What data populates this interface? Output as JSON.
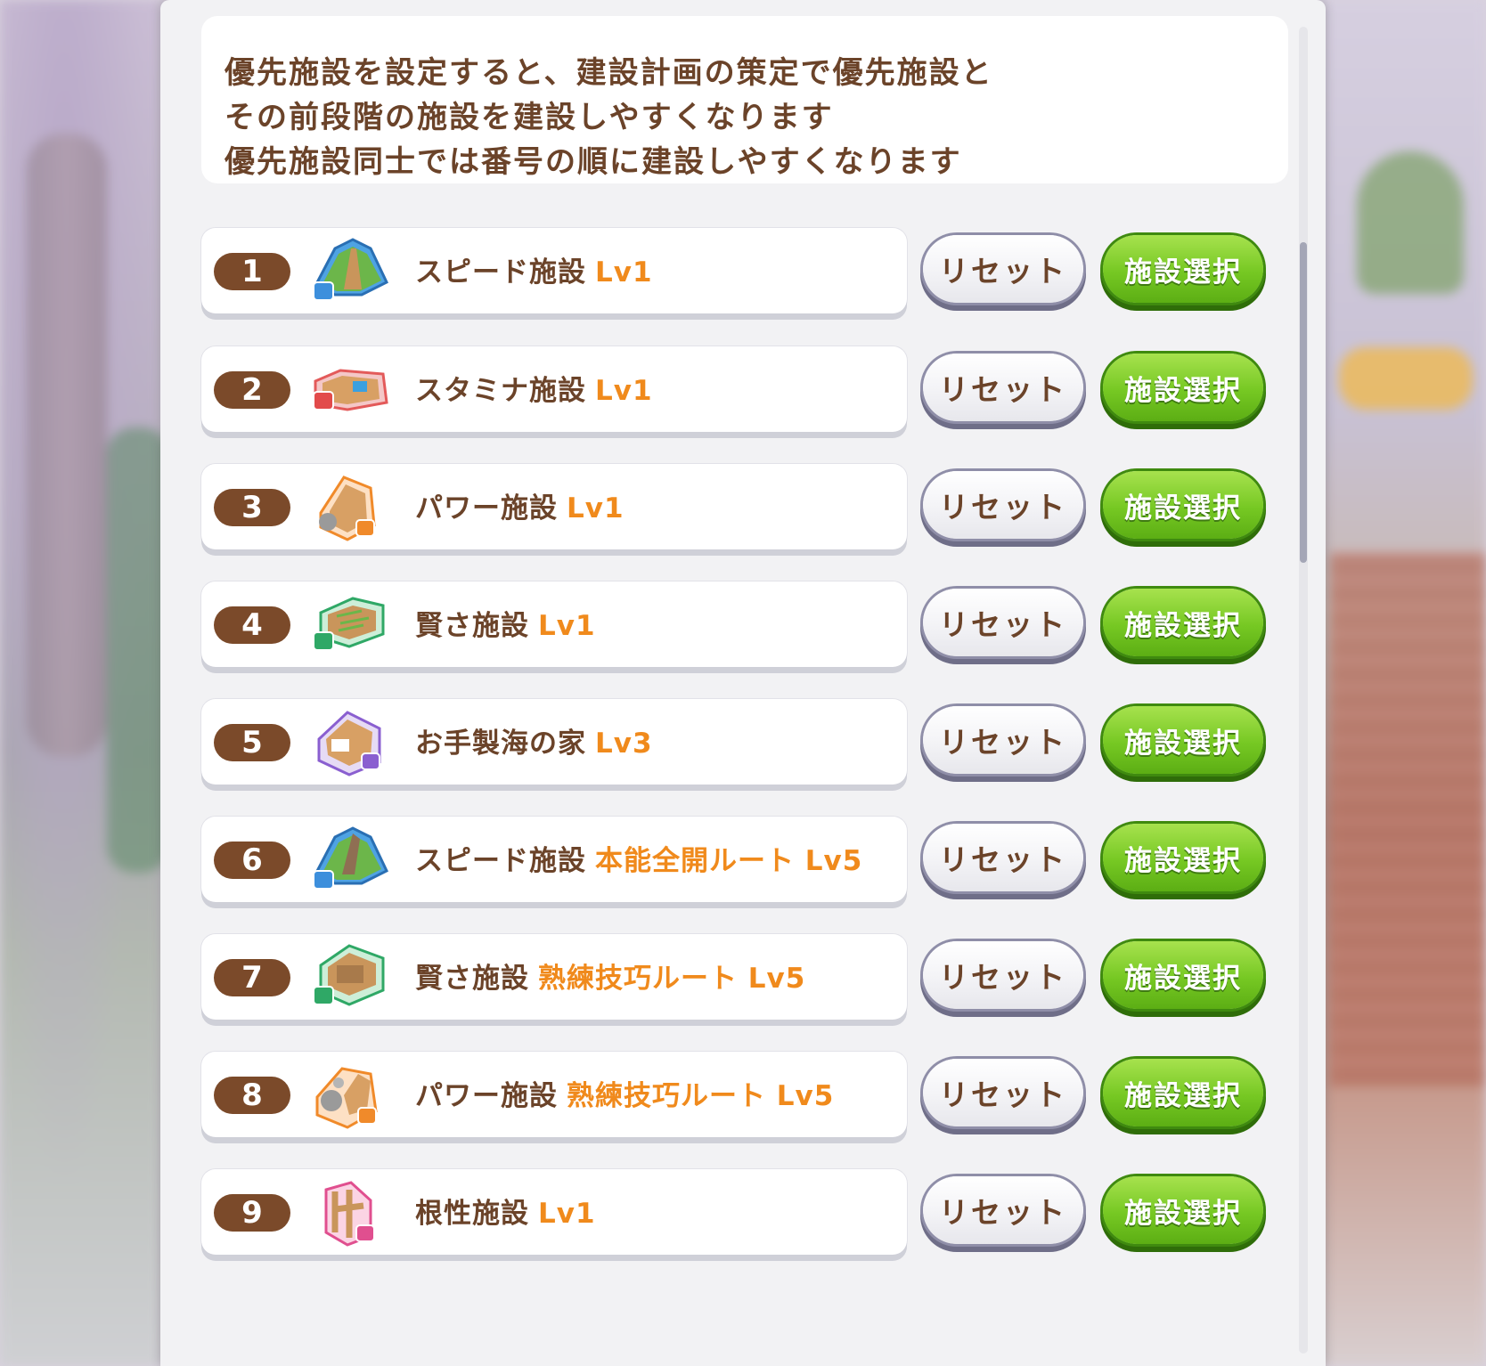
{
  "info": {
    "line1": "優先施設を設定すると、建設計画の策定で優先施設と",
    "line2": "その前段階の施設を建設しやすくなります",
    "line3": "優先施設同士では番号の順に建設しやすくなります"
  },
  "buttons": {
    "reset_label": "リセット",
    "select_label": "施設選択"
  },
  "colors": {
    "name_text": "#6b4329",
    "level_text": "#f08a1c",
    "number_pill": "#7b4a2a",
    "select_button": "#76c823"
  },
  "rows": [
    {
      "number": "1",
      "name": "スピード施設",
      "level": "Lv1",
      "icon": "speed-facility-icon"
    },
    {
      "number": "2",
      "name": "スタミナ施設",
      "level": "Lv1",
      "icon": "stamina-facility-icon"
    },
    {
      "number": "3",
      "name": "パワー施設",
      "level": "Lv1",
      "icon": "power-facility-icon"
    },
    {
      "number": "4",
      "name": "賢さ施設",
      "level": "Lv1",
      "icon": "wisdom-facility-icon"
    },
    {
      "number": "5",
      "name": "お手製海の家",
      "level": "Lv3",
      "icon": "beach-house-icon"
    },
    {
      "number": "6",
      "name": "スピード施設",
      "level": "本能全開ルート Lv5",
      "icon": "speed-facility-icon"
    },
    {
      "number": "7",
      "name": "賢さ施設",
      "level": "熟練技巧ルート Lv5",
      "icon": "wisdom-facility-icon"
    },
    {
      "number": "8",
      "name": "パワー施設",
      "level": "熟練技巧ルート Lv5",
      "icon": "power-facility-icon"
    },
    {
      "number": "9",
      "name": "根性施設",
      "level": "Lv1",
      "icon": "guts-facility-icon"
    }
  ]
}
